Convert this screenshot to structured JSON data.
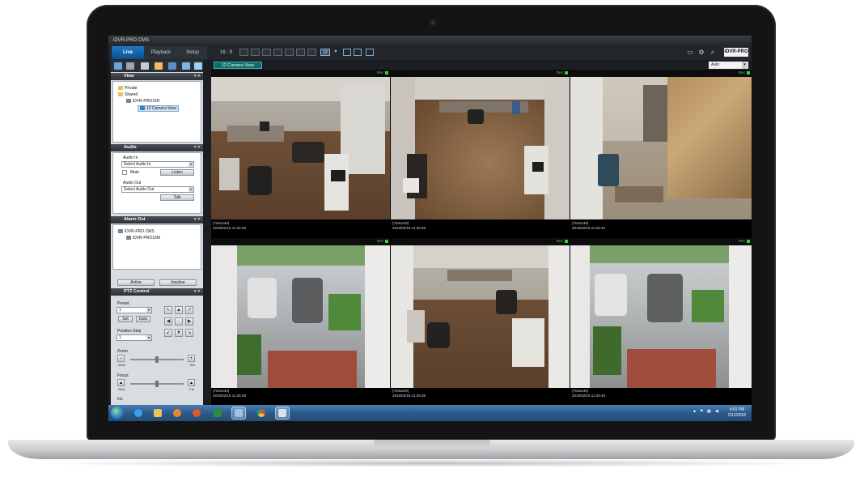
{
  "window": {
    "title": "iDVR-PRO CMS"
  },
  "tabs": [
    {
      "label": "Live"
    },
    {
      "label": "Playback"
    },
    {
      "label": "Setup"
    }
  ],
  "toolbar": {
    "layout_label": "16 : 9",
    "layout_number": "12",
    "logo_text": "iDVR-PRO",
    "stream_select": "Auto"
  },
  "view_tab": {
    "label": "12 Camera View"
  },
  "panels": {
    "view": {
      "title": "View",
      "tree": [
        {
          "label": "Private",
          "icon": "folder-icon"
        },
        {
          "label": "Shared",
          "icon": "folder-icon"
        },
        {
          "label": "iDVR-PRO16H",
          "icon": "dvr-icon"
        },
        {
          "label": "12 Camera View",
          "icon": "camera-view-icon"
        }
      ]
    },
    "audio": {
      "title": "Audio",
      "audio_in_label": "Audio In",
      "audio_in_value": "Select Audio In",
      "mute_label": "Mute",
      "listen_label": "Listen",
      "audio_out_label": "Audio Out",
      "audio_out_value": "Select Audio Out",
      "talk_label": "Talk"
    },
    "alarm_out": {
      "title": "Alarm Out",
      "tree": [
        {
          "label": "iDVR-PRO CMS"
        },
        {
          "label": "iDVR-PRO16M"
        }
      ],
      "active_label": "Active",
      "inactive_label": "Inactive"
    },
    "ptz": {
      "title": "PTZ Control",
      "preset_label": "Preset",
      "preset_value": "1",
      "set_label": "Set",
      "goto_label": "Goto",
      "position_step_label": "Position Step",
      "position_step_value": "1",
      "zoom_label": "Zoom",
      "zoom_wide": "Wide",
      "zoom_tele": "Tele",
      "focus_label": "Focus",
      "focus_near": "Near",
      "focus_far": "Far",
      "iris_label": "Iris"
    }
  },
  "cameras": [
    {
      "rec": "Rec",
      "res": "(704x240)",
      "timestamp": "2016/02/16 11:25:39"
    },
    {
      "rec": "Rec",
      "res": "(704x240)",
      "timestamp": "2016/02/16 11:25:39"
    },
    {
      "rec": "Rec",
      "res": "(704x240)",
      "timestamp": "2016/02/16 11:25:40"
    },
    {
      "rec": "Rec",
      "res": "(704x240)",
      "timestamp": "2016/02/16 11:25:39"
    },
    {
      "rec": "Rec",
      "res": "(704x240)",
      "timestamp": "2016/02/16 11:25:39"
    },
    {
      "rec": "Rec",
      "res": "(704x240)",
      "timestamp": "2016/02/16 11:25:40"
    }
  ],
  "taskbar": {
    "apps": [
      {
        "icon": "ie-icon"
      },
      {
        "icon": "explorer-icon"
      },
      {
        "icon": "media-player-icon"
      },
      {
        "icon": "firefox-icon"
      },
      {
        "icon": "excel-icon"
      },
      {
        "icon": "cms-icon"
      },
      {
        "icon": "chrome-icon"
      },
      {
        "icon": "dvr-app-icon"
      }
    ],
    "time": "4:01 PM",
    "date": "2/12/2016"
  },
  "colors": {
    "accent": "#1f78c8",
    "rec_led": "#2fd23b",
    "view_tab": "#0e6d6b"
  }
}
